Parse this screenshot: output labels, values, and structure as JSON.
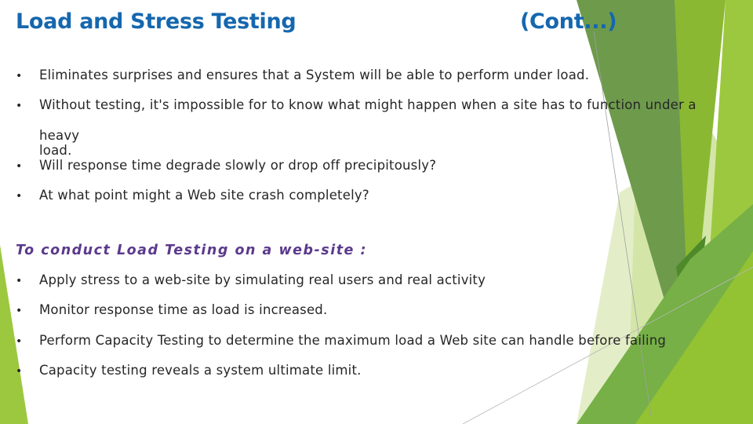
{
  "slide": {
    "title": "Load and Stress Testing",
    "title_suffix": "(Cont...)",
    "section1": {
      "bullets": [
        {
          "text": "Eliminates surprises and ensures that a System will be able to perform under load."
        },
        {
          "text": "Without testing, it's impossible for to know what might happen when a site has to function under a",
          "continuation": "heavy load."
        },
        {
          "text": "Will response time degrade slowly or drop off precipitously?"
        },
        {
          "text": "At what point might a Web site crash completely?"
        }
      ]
    },
    "subheading": "To conduct Load Testing on a web-site :",
    "section2": {
      "bullets": [
        {
          "text": "Apply stress to a web-site by simulating real users and real activity"
        },
        {
          "text": "Monitor response time as load is increased."
        },
        {
          "text": "Perform Capacity Testing to determine the maximum load a Web site can handle before failing"
        },
        {
          "text": "Capacity testing reveals a system ultimate limit."
        }
      ]
    },
    "bullet_symbol": "•",
    "colors": {
      "title": "#1567AE",
      "subheading": "#5B3A8C",
      "body_text": "#262626",
      "shape_dark_green": "#6E9A4C",
      "shape_mid_green": "#8AB833",
      "shape_lime": "#9CC83F",
      "shape_pale": "#D9E8B5",
      "shape_deep": "#4E8A2A"
    }
  }
}
